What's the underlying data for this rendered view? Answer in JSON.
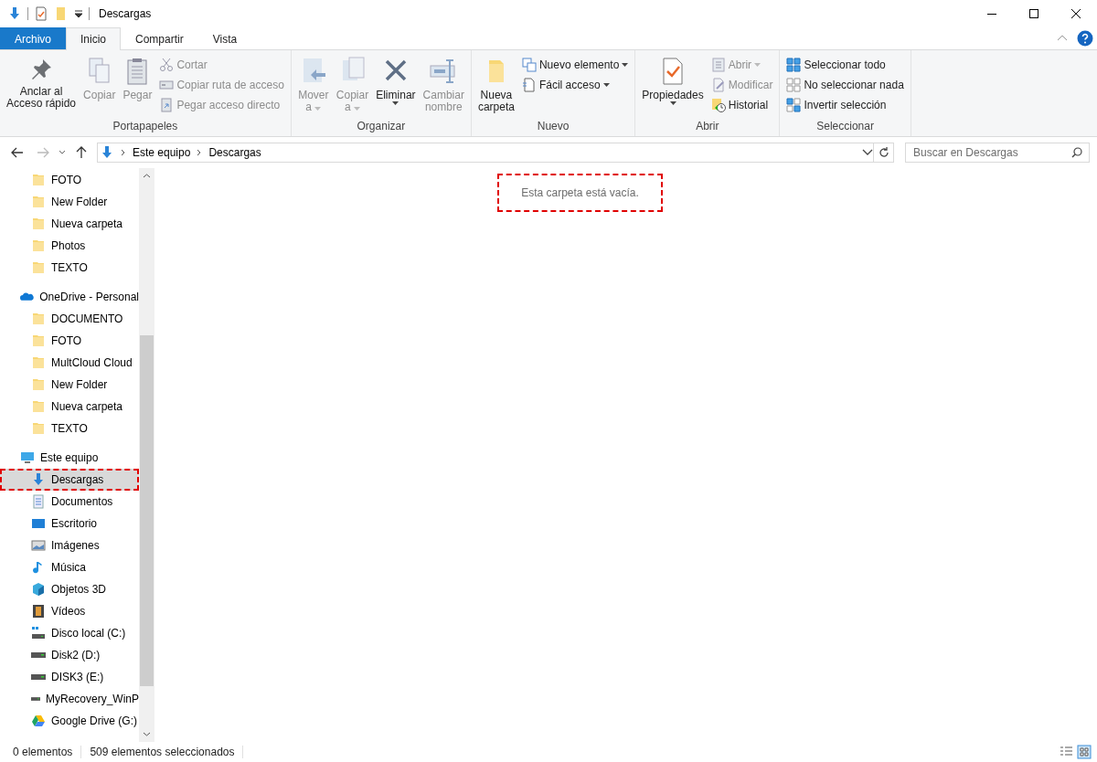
{
  "title_bar": {
    "title": "Descargas"
  },
  "ribbon_tabs": [
    {
      "label": "Archivo",
      "kind": "file",
      "selected": false
    },
    {
      "label": "Inicio",
      "kind": "tab",
      "selected": true
    },
    {
      "label": "Compartir",
      "kind": "tab",
      "selected": false
    },
    {
      "label": "Vista",
      "kind": "tab",
      "selected": false
    }
  ],
  "ribbon_groups": [
    {
      "label": "Portapapeles",
      "columns": [
        {
          "kind": "large",
          "lines": [
            "Anclar al",
            "Acceso rápido"
          ],
          "disabled": false
        },
        {
          "kind": "large",
          "lines": [
            "Copiar"
          ],
          "disabled": true
        },
        {
          "kind": "large",
          "lines": [
            "Pegar"
          ],
          "disabled": true
        },
        {
          "kind": "stack",
          "buttons": [
            {
              "label": "Cortar",
              "disabled": true
            },
            {
              "label": "Copiar ruta de acceso",
              "disabled": true
            },
            {
              "label": "Pegar acceso directo",
              "disabled": true
            }
          ]
        }
      ]
    },
    {
      "label": "Organizar",
      "columns": [
        {
          "kind": "large",
          "lines": [
            "Mover",
            "a"
          ],
          "dropdown": true,
          "disabled": true
        },
        {
          "kind": "large",
          "lines": [
            "Copiar",
            "a"
          ],
          "dropdown": true,
          "disabled": true
        },
        {
          "kind": "large",
          "lines": [
            "Eliminar"
          ],
          "dropdown": true,
          "disabled": false
        },
        {
          "kind": "large",
          "lines": [
            "Cambiar",
            "nombre"
          ],
          "disabled": true
        }
      ]
    },
    {
      "label": "Nuevo",
      "columns": [
        {
          "kind": "large",
          "lines": [
            "Nueva",
            "carpeta"
          ],
          "disabled": false
        },
        {
          "kind": "stack",
          "buttons": [
            {
              "label": "Nuevo elemento",
              "dropdown": true,
              "disabled": false
            },
            {
              "label": "Fácil acceso",
              "dropdown": true,
              "disabled": false
            }
          ]
        }
      ]
    },
    {
      "label": "Abrir",
      "columns": [
        {
          "kind": "large",
          "lines": [
            "Propiedades"
          ],
          "dropdown": true,
          "disabled": false
        },
        {
          "kind": "stack",
          "buttons": [
            {
              "label": "Abrir",
              "dropdown": true,
              "disabled": true
            },
            {
              "label": "Modificar",
              "disabled": true
            },
            {
              "label": "Historial",
              "disabled": false
            }
          ]
        }
      ]
    },
    {
      "label": "Seleccionar",
      "columns": [
        {
          "kind": "stack",
          "buttons": [
            {
              "label": "Seleccionar todo",
              "disabled": false
            },
            {
              "label": "No seleccionar nada",
              "disabled": false
            },
            {
              "label": "Invertir selección",
              "disabled": false
            }
          ]
        }
      ]
    }
  ],
  "address_bar": {
    "path": [
      "Este equipo",
      "Descargas"
    ]
  },
  "search": {
    "placeholder": "Buscar en Descargas"
  },
  "navigation": [
    {
      "kind": "group",
      "children": [
        {
          "label": "FOTO",
          "kind": "folder",
          "selected": false
        },
        {
          "label": "New Folder",
          "kind": "folder",
          "selected": false
        },
        {
          "label": "Nueva carpeta",
          "kind": "folder",
          "selected": false
        },
        {
          "label": "Photos",
          "kind": "folder",
          "selected": false
        },
        {
          "label": "TEXTO",
          "kind": "folder",
          "selected": false
        }
      ]
    },
    {
      "label": "OneDrive - Personal",
      "kind": "cloud",
      "selected": false,
      "children": [
        {
          "label": "DOCUMENTO",
          "kind": "folder",
          "selected": false
        },
        {
          "label": "FOTO",
          "kind": "folder",
          "selected": false
        },
        {
          "label": "MultCloud Cloud",
          "kind": "folder",
          "selected": false
        },
        {
          "label": "New Folder",
          "kind": "folder",
          "selected": false
        },
        {
          "label": "Nueva carpeta",
          "kind": "folder",
          "selected": false
        },
        {
          "label": "TEXTO",
          "kind": "folder",
          "selected": false
        }
      ]
    },
    {
      "label": "Este equipo",
      "kind": "pc",
      "selected": false,
      "children": [
        {
          "label": "Descargas",
          "kind": "download",
          "selected": true,
          "highlighted": true
        },
        {
          "label": "Documentos",
          "kind": "documents",
          "selected": false
        },
        {
          "label": "Escritorio",
          "kind": "desktop",
          "selected": false
        },
        {
          "label": "Imágenes",
          "kind": "pictures",
          "selected": false
        },
        {
          "label": "Música",
          "kind": "music",
          "selected": false
        },
        {
          "label": "Objetos 3D",
          "kind": "objects",
          "selected": false
        },
        {
          "label": "Vídeos",
          "kind": "videos",
          "selected": false
        },
        {
          "label": "Disco local (C:)",
          "kind": "system_drive",
          "selected": false
        },
        {
          "label": "Disk2 (D:)",
          "kind": "drive",
          "selected": false
        },
        {
          "label": "DISK3 (E:)",
          "kind": "drive",
          "selected": false
        },
        {
          "label": "MyRecovery_WinP",
          "kind": "drive",
          "selected": false
        },
        {
          "label": "Google Drive (G:)",
          "kind": "gdrive",
          "selected": false
        }
      ]
    }
  ],
  "content": {
    "empty_message": "Esta carpeta está vacía.",
    "highlighted": true
  },
  "status_bar": {
    "items": [
      "0 elementos",
      "509 elementos seleccionados"
    ]
  }
}
